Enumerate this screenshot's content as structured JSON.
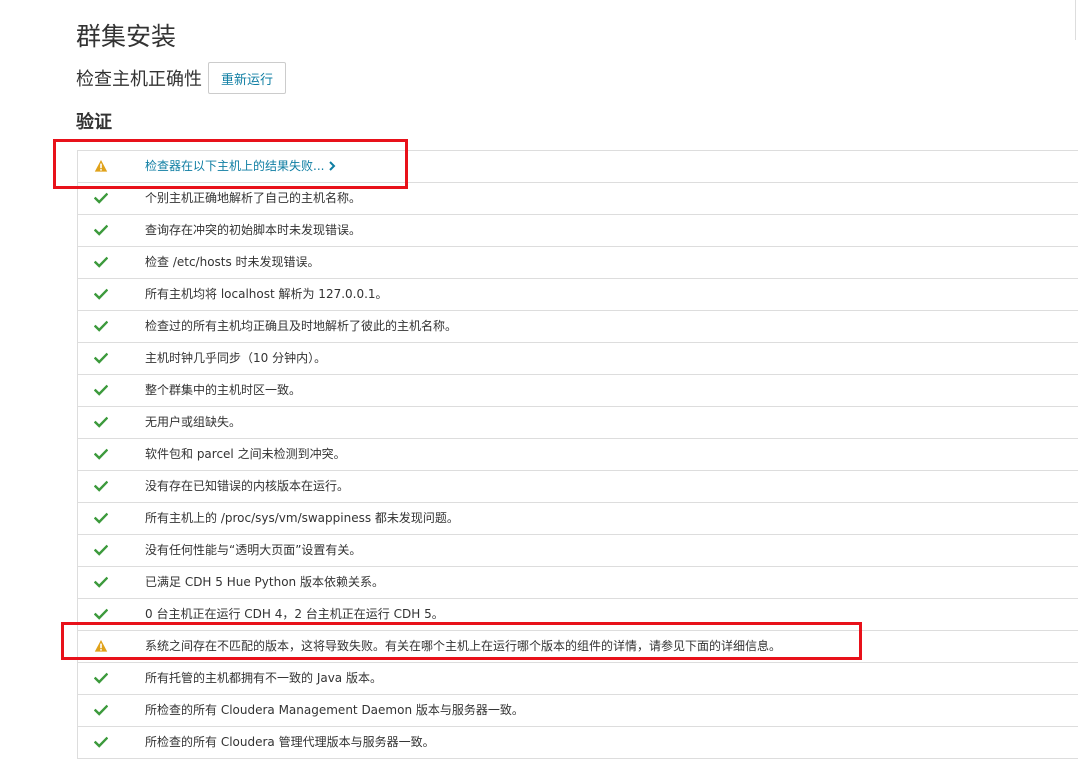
{
  "header": {
    "title": "群集安装",
    "subtitle": "检查主机正确性",
    "rerun_label": "重新运行"
  },
  "validation": {
    "title": "验证",
    "checks": [
      {
        "status": "warning",
        "text": "检查器在以下主机上的结果失败...",
        "link": true
      },
      {
        "status": "ok",
        "text": "个别主机正确地解析了自己的主机名称。"
      },
      {
        "status": "ok",
        "text": "查询存在冲突的初始脚本时未发现错误。"
      },
      {
        "status": "ok",
        "text": "检查 /etc/hosts 时未发现错误。"
      },
      {
        "status": "ok",
        "text": "所有主机均将 localhost 解析为 127.0.0.1。"
      },
      {
        "status": "ok",
        "text": "检查过的所有主机均正确且及时地解析了彼此的主机名称。"
      },
      {
        "status": "ok",
        "text": "主机时钟几乎同步（10 分钟内）。"
      },
      {
        "status": "ok",
        "text": "整个群集中的主机时区一致。"
      },
      {
        "status": "ok",
        "text": "无用户或组缺失。"
      },
      {
        "status": "ok",
        "text": "软件包和 parcel 之间未检测到冲突。"
      },
      {
        "status": "ok",
        "text": "没有存在已知错误的内核版本在运行。"
      },
      {
        "status": "ok",
        "text": "所有主机上的 /proc/sys/vm/swappiness 都未发现问题。"
      },
      {
        "status": "ok",
        "text": "没有任何性能与“透明大页面”设置有关。"
      },
      {
        "status": "ok",
        "text": "已满足 CDH 5 Hue Python 版本依赖关系。"
      },
      {
        "status": "ok",
        "text": "0 台主机正在运行 CDH 4，2 台主机正在运行 CDH 5。"
      },
      {
        "status": "warning",
        "text": "系统之间存在不匹配的版本，这将导致失败。有关在哪个主机上在运行哪个版本的组件的详情，请参见下面的详细信息。"
      },
      {
        "status": "ok",
        "text": "所有托管的主机都拥有不一致的 Java 版本。"
      },
      {
        "status": "ok",
        "text": "所检查的所有 Cloudera Management Daemon 版本与服务器一致。"
      },
      {
        "status": "ok",
        "text": "所检查的所有 Cloudera 管理代理版本与服务器一致。"
      }
    ]
  },
  "colors": {
    "link": "#0f7ea3",
    "ok": "#3c9a3c",
    "warning": "#e0a21a",
    "annotation": "#e8111a"
  },
  "icons": {
    "ok": "check-icon",
    "warning": "warning-triangle-icon",
    "more": "chevron-right-icon"
  }
}
